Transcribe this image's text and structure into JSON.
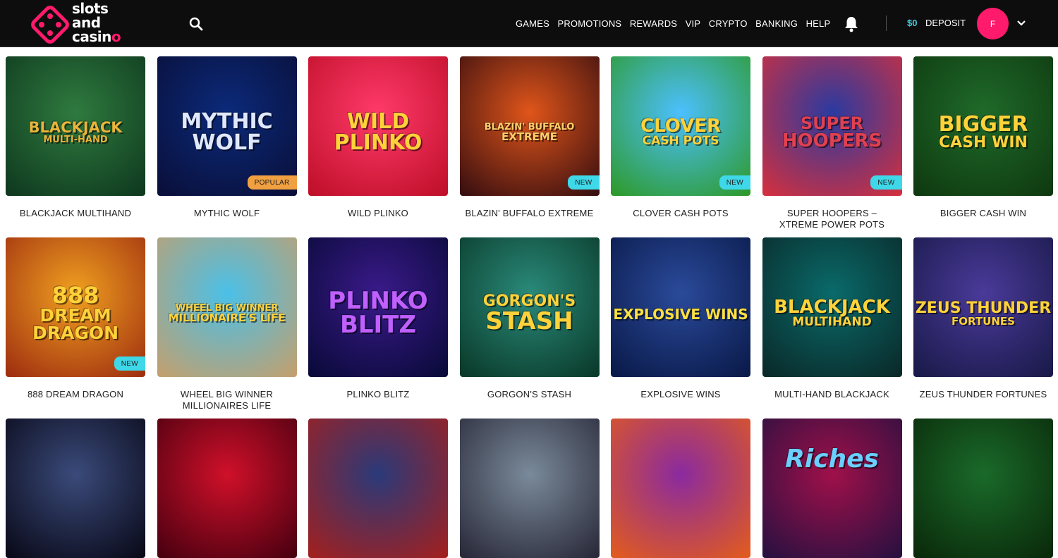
{
  "brand": {
    "line1": "slots",
    "line2": "and",
    "line3": "casin",
    "line3_o": "o"
  },
  "nav": [
    "GAMES",
    "PROMOTIONS",
    "REWARDS",
    "VIP",
    "CRYPTO",
    "BANKING",
    "HELP"
  ],
  "account": {
    "balance": "$0",
    "deposit": "DEPOSIT",
    "avatar_initial": "F"
  },
  "colors": {
    "accent": "#ff1a6b",
    "badge_new": "#3fd8e8",
    "badge_popular": "#f0a040",
    "balance": "#3fd0e0"
  },
  "rows": [
    [
      {
        "title": "BLACKJACK MULTIHAND",
        "art": [
          "BLACKJACK",
          "MULTI-HAND"
        ],
        "badge": ""
      },
      {
        "title": "MYTHIC WOLF",
        "art": [
          "MYTHIC",
          "WOLF"
        ],
        "badge": "POPULAR"
      },
      {
        "title": "WILD PLINKO",
        "art": [
          "WILD",
          "PLINKO"
        ],
        "badge": ""
      },
      {
        "title": "BLAZIN' BUFFALO EXTREME",
        "art": [
          "BLAZIN' BUFFALO",
          "EXTREME"
        ],
        "badge": "NEW"
      },
      {
        "title": "CLOVER CASH POTS",
        "art": [
          "CLOVER",
          "CASH POTS"
        ],
        "badge": "NEW"
      },
      {
        "title": "SUPER HOOPERS – XTREME POWER POTS",
        "art": [
          "SUPER",
          "HOOPERS"
        ],
        "badge": "NEW"
      },
      {
        "title": "BIGGER CASH WIN",
        "art": [
          "BIGGER",
          "CASH WIN"
        ],
        "badge": ""
      }
    ],
    [
      {
        "title": "888 DREAM DRAGON",
        "art": [
          "888",
          "DREAM",
          "DRAGON"
        ],
        "badge": "NEW"
      },
      {
        "title": "WHEEL BIG WINNER MILLIONAIRES LIFE",
        "art": [
          "WHEEL BIG WINNER",
          "MILLIONAIRE'S LIFE"
        ],
        "badge": ""
      },
      {
        "title": "PLINKO BLITZ",
        "art": [
          "PLINKO",
          "BLITZ"
        ],
        "badge": ""
      },
      {
        "title": "GORGON'S STASH",
        "art": [
          "GORGON'S",
          "STASH"
        ],
        "badge": ""
      },
      {
        "title": "EXPLOSIVE WINS",
        "art": [
          "EXPLOSIVE WINS"
        ],
        "badge": ""
      },
      {
        "title": "MULTI-HAND BLACKJACK",
        "art": [
          "BLACKJACK",
          "MULTIHAND"
        ],
        "badge": ""
      },
      {
        "title": "ZEUS THUNDER FORTUNES",
        "art": [
          "ZEUS THUNDER",
          "FORTUNES"
        ],
        "badge": ""
      }
    ],
    [
      {
        "title": "",
        "art": [],
        "badge": ""
      },
      {
        "title": "",
        "art": [],
        "badge": ""
      },
      {
        "title": "",
        "art": [],
        "badge": ""
      },
      {
        "title": "",
        "art": [],
        "badge": ""
      },
      {
        "title": "",
        "art": [],
        "badge": ""
      },
      {
        "title": "",
        "art": [
          "Riches"
        ],
        "badge": ""
      },
      {
        "title": "",
        "art": [],
        "badge": ""
      }
    ]
  ]
}
